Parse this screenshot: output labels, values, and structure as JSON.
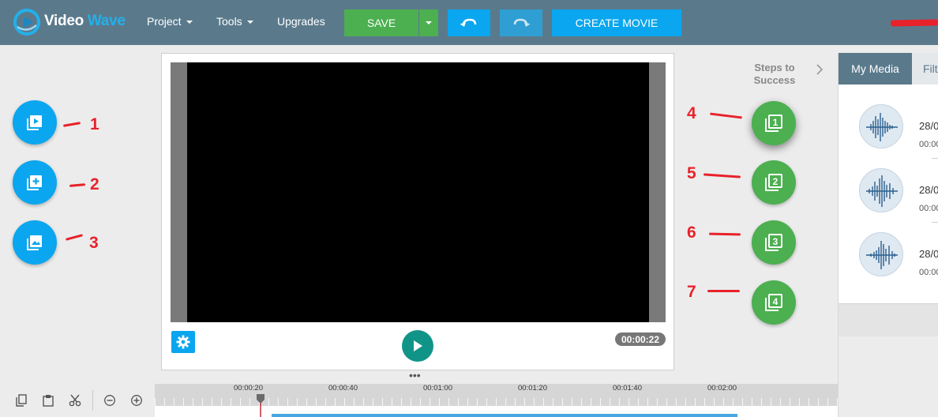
{
  "app": {
    "name_part1": "Video",
    "name_part2": "Wave",
    "menu": [
      {
        "label": "Project",
        "has_caret": true
      },
      {
        "label": "Tools",
        "has_caret": true
      },
      {
        "label": "Upgrades",
        "has_caret": false
      }
    ],
    "save_label": "SAVE",
    "create_label": "CREATE MOVIE",
    "accent_colors": {
      "primary_blue": "#0aa6ef",
      "green": "#4caf50",
      "topbar": "#5a7a8c",
      "annotation_red": "#e8222a",
      "teal": "#119488"
    }
  },
  "left_buttons": [
    {
      "icon": "add-video-icon",
      "annotation": "1"
    },
    {
      "icon": "add-to-library-icon",
      "annotation": "2"
    },
    {
      "icon": "add-image-icon",
      "annotation": "3"
    }
  ],
  "preview": {
    "timecode": "00:00:22",
    "settings_icon": "gear-icon",
    "play_icon": "play-icon"
  },
  "steps": {
    "title_line1": "Steps to",
    "title_line2": "Success",
    "items": [
      {
        "number": "1",
        "annotation": "4",
        "active": true
      },
      {
        "number": "2",
        "annotation": "5",
        "active": false
      },
      {
        "number": "3",
        "annotation": "6",
        "active": false
      },
      {
        "number": "4",
        "annotation": "7",
        "active": false
      }
    ]
  },
  "media_panel": {
    "tab_active": "My Media",
    "tab_other": "Filter",
    "items": [
      {
        "date": "28/0",
        "duration": "00:00"
      },
      {
        "date": "28/0",
        "duration": "00:00"
      },
      {
        "date": "28/0",
        "duration": "00:00"
      }
    ]
  },
  "timeline": {
    "tick_labels": [
      "00:00:20",
      "00:00:40",
      "00:01:00",
      "00:01:20",
      "00:01:40",
      "00:02:00"
    ],
    "tools": [
      "copy-icon",
      "paste-icon",
      "cut-icon",
      "zoom-out-icon",
      "zoom-in-icon"
    ]
  }
}
